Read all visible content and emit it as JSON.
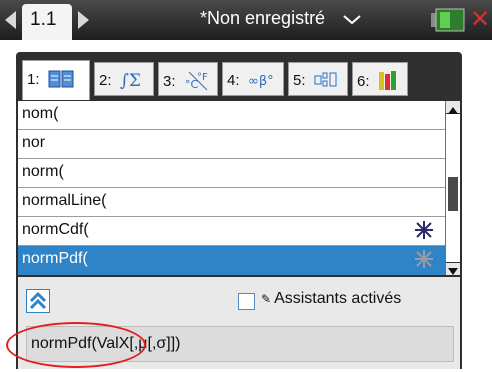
{
  "topbar": {
    "page_tab": "1.1",
    "doc_title": "*Non enregistré"
  },
  "catalog": {
    "tabs": [
      {
        "num": "1:",
        "icon": "book-icon"
      },
      {
        "num": "2:",
        "icon": "integral-sum-icon"
      },
      {
        "num": "3:",
        "icon": "units-icon"
      },
      {
        "num": "4:",
        "icon": "symbols-icon"
      },
      {
        "num": "5:",
        "icon": "templates-icon"
      },
      {
        "num": "6:",
        "icon": "libraries-icon"
      }
    ],
    "items": [
      "nom(",
      "nor",
      "norm(",
      "normalLine(",
      "normCdf(",
      "normPdf("
    ],
    "selected_index": 5,
    "wizard_icon_rows": [
      4,
      5
    ]
  },
  "bottom": {
    "wizards_label": "Assistants activés",
    "wizards_checked": false,
    "syntax": "normPdf(ValX[,μ[,σ]])"
  },
  "colors": {
    "selection": "#2f84c8",
    "annotation": "#e02020"
  }
}
